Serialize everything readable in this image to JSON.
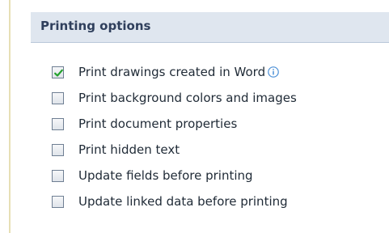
{
  "section": {
    "title": "Printing options"
  },
  "options": [
    {
      "label": "Print drawings created in Word",
      "checked": true,
      "has_info_icon": true
    },
    {
      "label": "Print background colors and images",
      "checked": false,
      "has_info_icon": false
    },
    {
      "label": "Print document properties",
      "checked": false,
      "has_info_icon": false
    },
    {
      "label": "Print hidden text",
      "checked": false,
      "has_info_icon": false
    },
    {
      "label": "Update fields before printing",
      "checked": false,
      "has_info_icon": false
    },
    {
      "label": "Update linked data before printing",
      "checked": false,
      "has_info_icon": false
    }
  ],
  "icons": {
    "checkmark": "checkmark-icon",
    "info": "info-icon"
  },
  "colors": {
    "header_background": "#dfe6ef",
    "header_text": "#2f3f5c",
    "checkmark": "#22a12c",
    "info_icon": "#4a8fd6"
  }
}
